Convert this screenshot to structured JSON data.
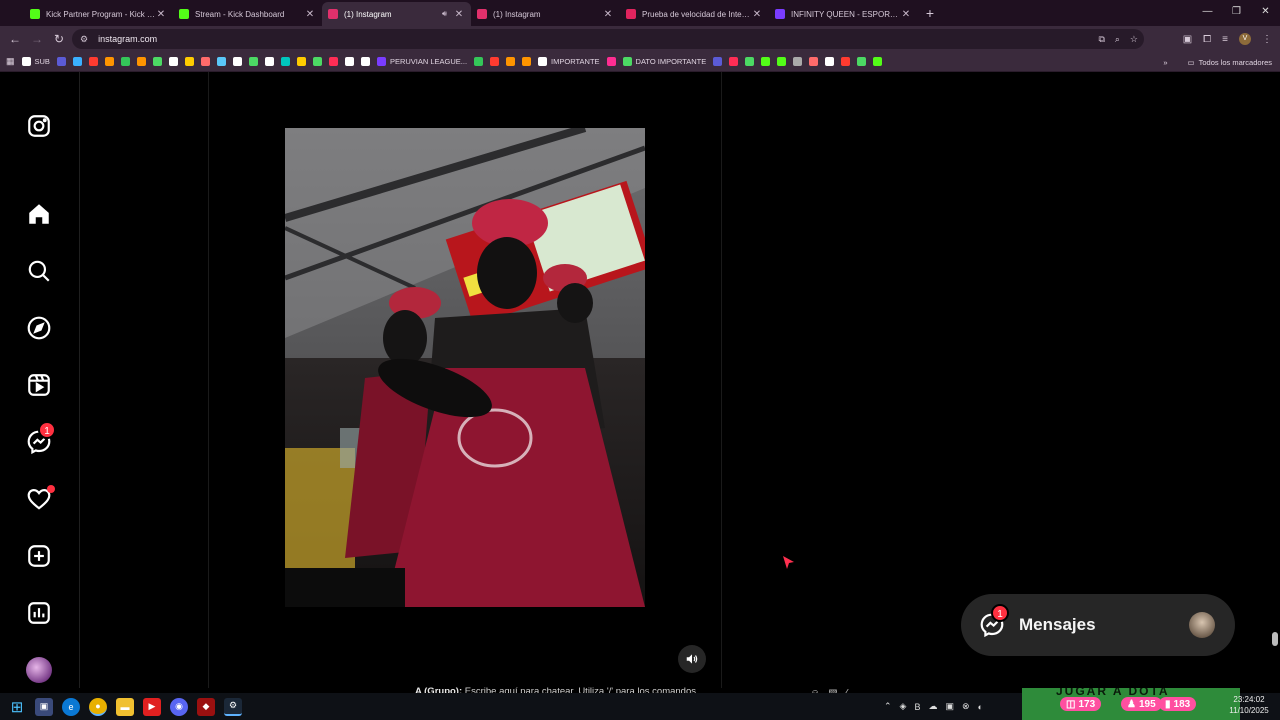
{
  "browser": {
    "tabs": [
      {
        "title": "Kick Partner Program - Kick Da",
        "icon": "kick-icon",
        "color": "#53fc18",
        "active": false
      },
      {
        "title": "Stream - Kick Dashboard",
        "icon": "kick-icon",
        "color": "#53fc18",
        "active": false
      },
      {
        "title": "(1) Instagram",
        "icon": "instagram-icon",
        "color": "#e1306c",
        "active": true,
        "audio": true
      },
      {
        "title": "(1) Instagram",
        "icon": "instagram-icon",
        "color": "#e1306c",
        "active": false
      },
      {
        "title": "Prueba de velocidad de Interne",
        "icon": "speedtest-icon",
        "color": "#e0245e",
        "active": false
      },
      {
        "title": "INFINITY QUEEN - ESPORTS FE",
        "icon": "esports-icon",
        "color": "#7a3cff",
        "active": false
      }
    ],
    "url": "instagram.com",
    "profile_initial": "V",
    "bookmarks": [
      {
        "label": "SUB",
        "color": "#ffffff"
      },
      {
        "label": "",
        "color": "#5b5bd6"
      },
      {
        "label": "",
        "color": "#3ab0ff"
      },
      {
        "label": "",
        "color": "#ff3b30"
      },
      {
        "label": "",
        "color": "#ff9500"
      },
      {
        "label": "",
        "color": "#34c759"
      },
      {
        "label": "",
        "color": "#ff9500"
      },
      {
        "label": "",
        "color": "#4cd964"
      },
      {
        "label": "",
        "color": "#ffffff"
      },
      {
        "label": "",
        "color": "#ffcc00"
      },
      {
        "label": "",
        "color": "#ff6b6b"
      },
      {
        "label": "",
        "color": "#5ac8fa"
      },
      {
        "label": "",
        "color": "#ffffff"
      },
      {
        "label": "",
        "color": "#4cd964"
      },
      {
        "label": "",
        "color": "#ffffff"
      },
      {
        "label": "",
        "color": "#00c7be"
      },
      {
        "label": "",
        "color": "#ffcc00"
      },
      {
        "label": "",
        "color": "#4cd964"
      },
      {
        "label": "",
        "color": "#ff2d55"
      },
      {
        "label": "",
        "color": "#ffffff"
      },
      {
        "label": "",
        "color": "#ffffff"
      },
      {
        "label": "PERUVIAN LEAGUE...",
        "color": "#7a3cff"
      },
      {
        "label": "",
        "color": "#34c759"
      },
      {
        "label": "",
        "color": "#ff3b30"
      },
      {
        "label": "",
        "color": "#ff9500"
      },
      {
        "label": "",
        "color": "#ff9500"
      },
      {
        "label": "IMPORTANTE",
        "color": "#ffffff"
      },
      {
        "label": "",
        "color": "#ff2d92"
      },
      {
        "label": "DATO IMPORTANTE",
        "color": "#4cd964"
      },
      {
        "label": "",
        "color": "#5b5bd6"
      },
      {
        "label": "",
        "color": "#ff2d55"
      },
      {
        "label": "",
        "color": "#4cd964"
      },
      {
        "label": "",
        "color": "#53fc18"
      },
      {
        "label": "",
        "color": "#53fc18"
      },
      {
        "label": "",
        "color": "#aaaaaa"
      },
      {
        "label": "",
        "color": "#ff6b6b"
      },
      {
        "label": "",
        "color": "#ffffff"
      },
      {
        "label": "",
        "color": "#ff3b30"
      },
      {
        "label": "",
        "color": "#4cd964"
      },
      {
        "label": "",
        "color": "#53fc18"
      }
    ],
    "all_bookmarks_label": "Todos los marcadores"
  },
  "instagram": {
    "messages_badge": "1",
    "messages_pill_label": "Mensajes",
    "messages_pill_badge": "1"
  },
  "game_chat": {
    "prefix": "A (Grupo):",
    "placeholder": "Escribe aquí para chatear. Utiliza '/' para los comandos."
  },
  "taskbar": {
    "banner_text": "JUGAR A DOTA",
    "stat_1": "173",
    "stat_2": "195",
    "stat_3": "183",
    "time": "23:24:02",
    "date": "11/10/2025"
  },
  "colors": {
    "ig_badge": "#ff3040",
    "chrome_bg": "#3a2a3c",
    "stat_pink": "#ff4fa0"
  }
}
